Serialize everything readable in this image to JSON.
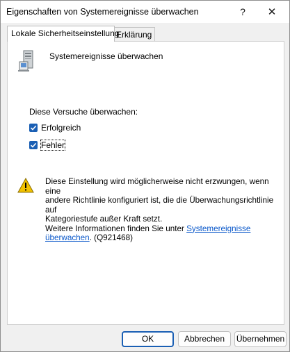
{
  "window": {
    "title": "Eigenschaften von Systemereignisse überwachen",
    "help_glyph": "?",
    "close_glyph": "✕"
  },
  "tabs": [
    {
      "label": "Lokale Sicherheitseinstellung",
      "active": true
    },
    {
      "label": "Erklärung",
      "active": false
    }
  ],
  "policy": {
    "icon": "server-icon",
    "name": "Systemereignisse überwachen"
  },
  "audit": {
    "label": "Diese Versuche überwachen:",
    "options": [
      {
        "label": "Erfolgreich",
        "checked": true
      },
      {
        "label": "Fehler",
        "checked": true
      }
    ]
  },
  "warning": {
    "icon": "warning-icon",
    "line1": "Diese Einstellung wird möglicherweise nicht erzwungen, wenn eine",
    "line2": "andere Richtlinie konfiguriert ist, die die Überwachungsrichtlinie auf",
    "line3": "Kategoriestufe außer Kraft setzt.",
    "line4_prefix": "Weitere Informationen finden Sie unter ",
    "link_part1": "Systemereignisse",
    "link_part2": "überwachen",
    "suffix": ". (Q921468)"
  },
  "buttons": {
    "ok": "OK",
    "cancel": "Abbrechen",
    "apply": "Übernehmen"
  },
  "colors": {
    "accent": "#1a5fb4",
    "link": "#0a58ca",
    "warning": "#f2c200"
  }
}
